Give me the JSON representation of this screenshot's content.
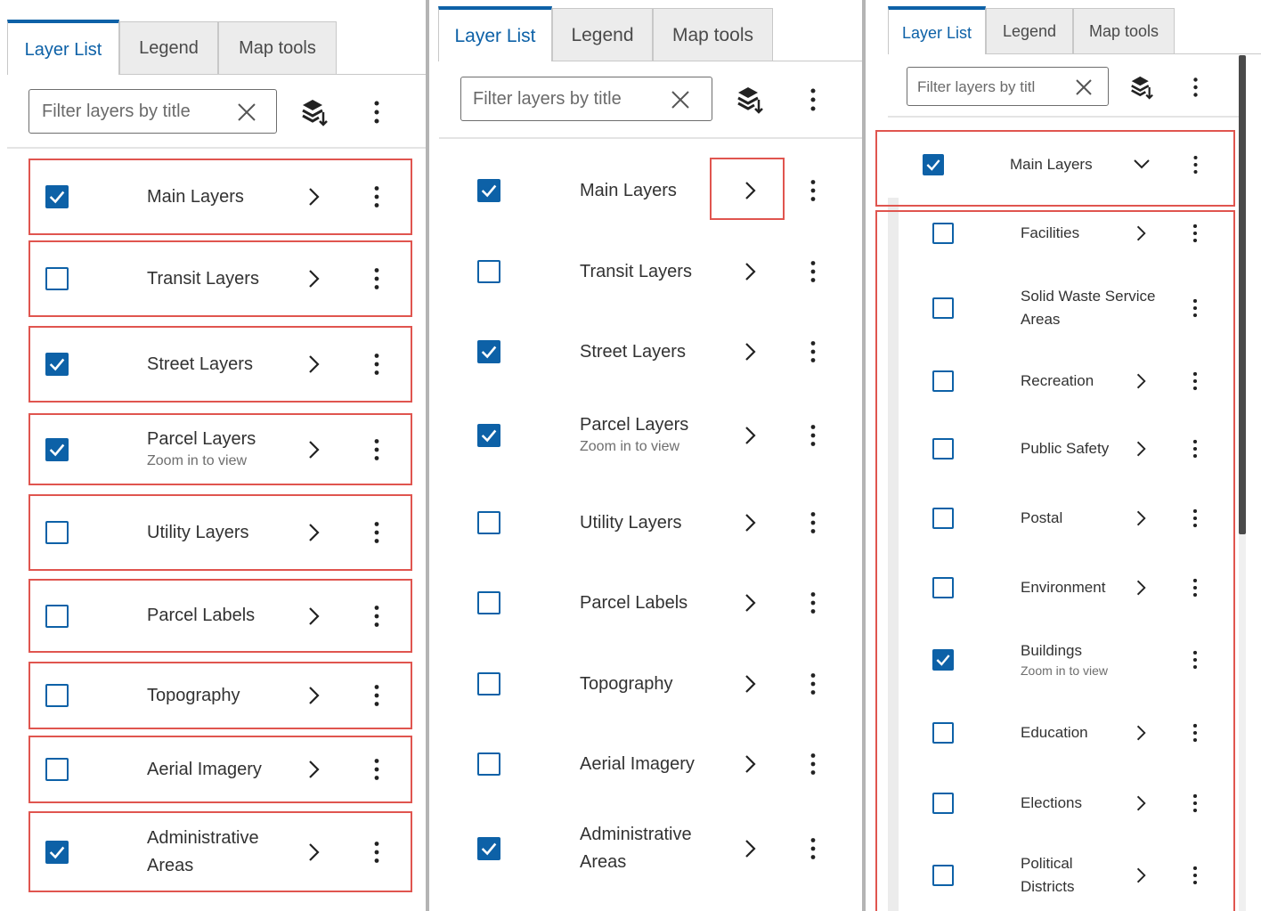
{
  "colors": {
    "accent": "#0d61a7",
    "highlight_border": "#e0554f",
    "text": "#323232",
    "muted": "#6e6e6e"
  },
  "tabs": {
    "layer_list": "Layer List",
    "legend": "Legend",
    "map_tools": "Map tools"
  },
  "filter": {
    "placeholder_full": "Filter layers by title",
    "placeholder_truncated": "Filter layers by titl"
  },
  "icons": {
    "clear": "close-icon",
    "layers_tool": "layers-stack-icon",
    "menu": "vertical-dots-icon",
    "expand": "chevron-right-icon",
    "collapse": "chevron-down-icon"
  },
  "main_layers": [
    {
      "label": "Main Layers",
      "checked": true
    },
    {
      "label": "Transit Layers",
      "checked": false
    },
    {
      "label": "Street Layers",
      "checked": true
    },
    {
      "label": "Parcel Layers",
      "sublabel": "Zoom in to view",
      "checked": true
    },
    {
      "label": "Utility Layers",
      "checked": false
    },
    {
      "label": "Parcel Labels",
      "checked": false
    },
    {
      "label": "Topography",
      "checked": false
    },
    {
      "label": "Aerial Imagery",
      "checked": false
    },
    {
      "label": "Administrative",
      "label2": "Areas",
      "checked": true
    }
  ],
  "panel3": {
    "parent": {
      "label": "Main Layers",
      "checked": true,
      "expanded": true
    },
    "children": [
      {
        "label": "Facilities",
        "checked": false,
        "has_children": true
      },
      {
        "label": "Solid Waste Service",
        "label2": "Areas",
        "checked": false,
        "has_children": false
      },
      {
        "label": "Recreation",
        "checked": false,
        "has_children": true
      },
      {
        "label": "Public Safety",
        "checked": false,
        "has_children": true
      },
      {
        "label": "Postal",
        "checked": false,
        "has_children": true
      },
      {
        "label": "Environment",
        "checked": false,
        "has_children": true
      },
      {
        "label": "Buildings",
        "sublabel": "Zoom in to view",
        "checked": true,
        "has_children": false
      },
      {
        "label": "Education",
        "checked": false,
        "has_children": true
      },
      {
        "label": "Elections",
        "checked": false,
        "has_children": true
      },
      {
        "label": "Political",
        "label2": "Districts",
        "checked": false,
        "has_children": true
      }
    ]
  }
}
